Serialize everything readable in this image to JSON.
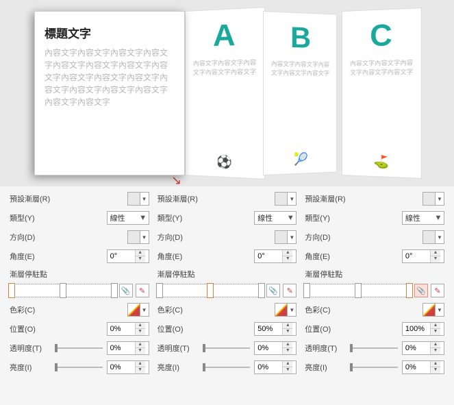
{
  "preview": {
    "cover_title": "標題文字",
    "cover_body": "內容文字內容文字內容文字內容文字內容文字內容文字內容文字內容文字內容文字內容文字內容文字內容文字內容文字內容文字內容文字內容文字內容文字",
    "panels": [
      {
        "letter": "A",
        "body": "內容文字內容文字內容文字內容文字內容文字"
      },
      {
        "letter": "B",
        "body": "內容文字內容文字內容文字內容文字內容文字"
      },
      {
        "letter": "C",
        "body": "內容文字內容文字內容文字內容文字內容文字"
      }
    ]
  },
  "labels": {
    "preset": "預設漸層(R)",
    "type": "類型(Y)",
    "direction": "方向(D)",
    "angle": "角度(E)",
    "stops": "漸層停駐點",
    "color": "色彩(C)",
    "position": "位置(O)",
    "transparency": "透明度(T)",
    "brightness": "亮度(I)"
  },
  "columns": [
    {
      "type": "線性",
      "angle": "0°",
      "position": "0%",
      "transparency": "0%",
      "brightness": "0%",
      "stop_left": "0%",
      "handles": [
        0,
        50,
        100
      ]
    },
    {
      "type": "線性",
      "angle": "0°",
      "position": "50%",
      "transparency": "0%",
      "brightness": "0%",
      "stop_left": "50%",
      "handles": [
        0,
        50,
        100
      ]
    },
    {
      "type": "線性",
      "angle": "0°",
      "position": "100%",
      "transparency": "0%",
      "brightness": "0%",
      "stop_left": "100%",
      "handles": [
        0,
        50,
        100
      ]
    }
  ]
}
